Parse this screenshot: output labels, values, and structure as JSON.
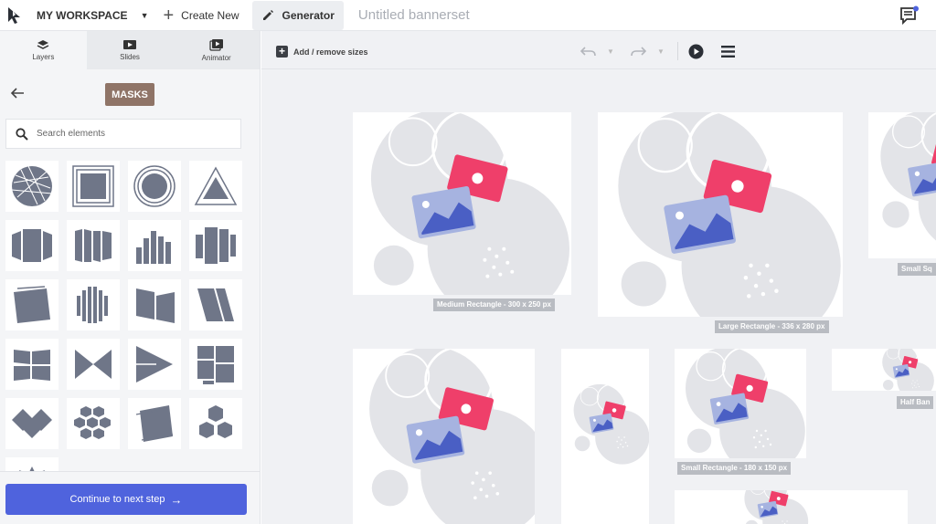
{
  "topbar": {
    "workspace_label": "MY WORKSPACE",
    "create_label": "Create New",
    "generator_label": "Generator",
    "doc_title": "Untitled bannerset",
    "logo_icon": "logo-cursor-icon",
    "chat_icon": "feedback-icon"
  },
  "leftpanel": {
    "tabs": [
      {
        "label": "Layers",
        "icon": "layers-icon"
      },
      {
        "label": "Slides",
        "icon": "slides-icon"
      },
      {
        "label": "Animator",
        "icon": "animator-icon"
      }
    ],
    "category_badge": "MASKS",
    "search_placeholder": "Search elements",
    "continue_label": "Continue to next step"
  },
  "toolbar": {
    "add_sizes_label": "Add / remove sizes"
  },
  "banners": [
    {
      "label": "Medium Rectangle - 300 x 250 px"
    },
    {
      "label": "Large Rectangle - 336 x 280 px"
    },
    {
      "label": "Small Sq"
    },
    {
      "label": "Small Rectangle - 180 x 150 px"
    },
    {
      "label": "Half Ban"
    }
  ],
  "colors": {
    "accent": "#4f63dd",
    "badge": "#8f7467",
    "pink": "#ef3f6a",
    "blue": "#4a5fc4",
    "lightblue": "#a6b3e0",
    "shape": "#6f7688",
    "circle": "#e3e4e8"
  }
}
